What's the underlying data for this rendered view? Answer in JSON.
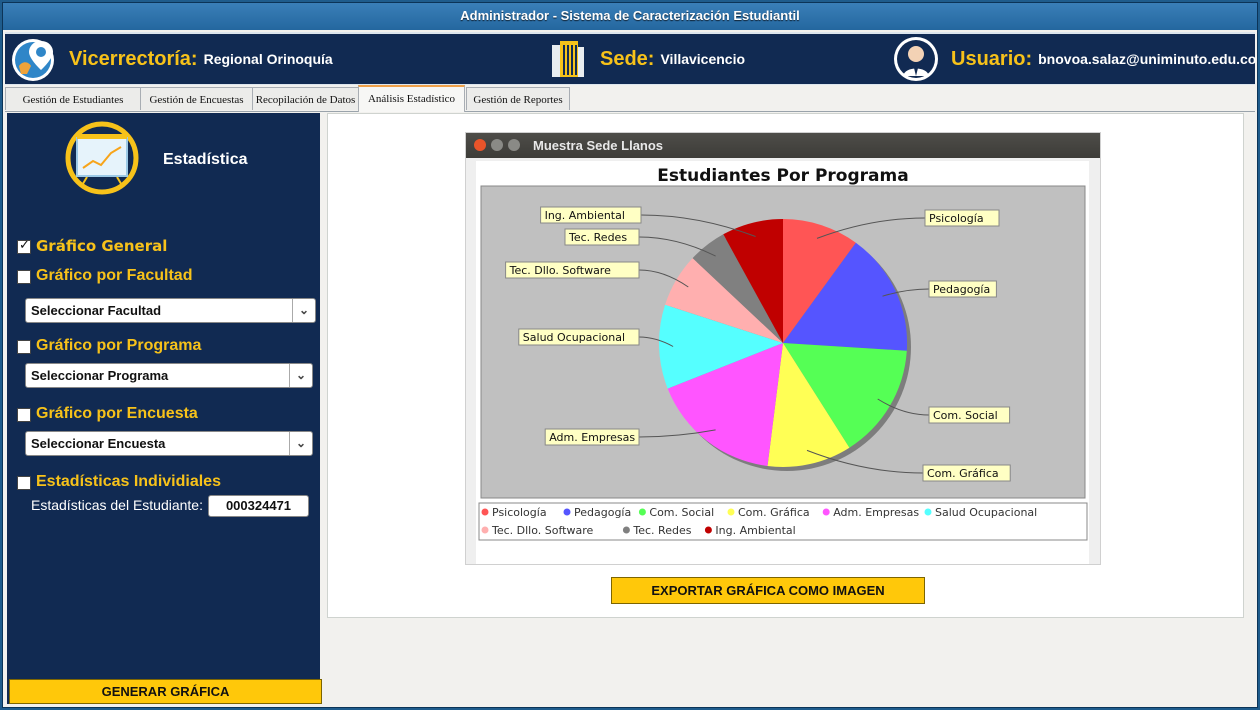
{
  "window": {
    "title": "Administrador - Sistema de Caracterización Estudiantil"
  },
  "header": {
    "vicerrectoria_key": "Vicerrectoría:",
    "vicerrectoria_value": "Regional Orinoquía",
    "sede_key": "Sede:",
    "sede_value": "Villavicencio",
    "usuario_key": "Usuario:",
    "usuario_value": "bnovoa.salaz@uniminuto.edu.co"
  },
  "tabs": [
    {
      "label": "Gestión de Estudiantes"
    },
    {
      "label": "Gestión de Encuestas"
    },
    {
      "label": "Recopilación de Datos"
    },
    {
      "label": "Análisis Estadístico",
      "active": true
    },
    {
      "label": "Gestión de Reportes"
    }
  ],
  "sidebar": {
    "title": "Estadística",
    "options": [
      {
        "label": "Gráfico General",
        "checked": true
      },
      {
        "label": "Gráfico por Facultad",
        "checked": false
      },
      {
        "label": "Gráfico por Programa",
        "checked": false
      },
      {
        "label": "Gráfico por Encuesta",
        "checked": false
      },
      {
        "label": "Estadísticas Individiales",
        "checked": false
      }
    ],
    "facultad_select": "Seleccionar Facultad",
    "programa_select": "Seleccionar Programa",
    "encuesta_select": "Seleccionar Encuesta",
    "student_label": "Estadísticas del Estudiante:",
    "student_id": "000324471",
    "generate_button": "GENERAR GRÁFICA"
  },
  "chart_window": {
    "title": "Muestra Sede Llanos"
  },
  "export_button": "EXPORTAR GRÁFICA COMO IMAGEN",
  "colors": {
    "accent": "#ffc80a",
    "header_bg": "#112a52",
    "label_yellow": "#f7c21a"
  },
  "chart_data": {
    "type": "pie",
    "title": "Estudiantes Por Programa",
    "unit": "percent",
    "slices": [
      {
        "label": "Psicología",
        "value": 10,
        "color": "#ff5555"
      },
      {
        "label": "Pedagogía",
        "value": 16,
        "color": "#5555ff"
      },
      {
        "label": "Com. Social",
        "value": 15,
        "color": "#55ff55"
      },
      {
        "label": "Com. Gráfica",
        "value": 11,
        "color": "#ffff55"
      },
      {
        "label": "Adm. Empresas",
        "value": 17,
        "color": "#ff55ff"
      },
      {
        "label": "Salud Ocupacional",
        "value": 11,
        "color": "#55ffff"
      },
      {
        "label": "Tec. Dllo. Software",
        "value": 7,
        "color": "#ffafaf"
      },
      {
        "label": "Tec. Redes",
        "value": 5,
        "color": "#808080"
      },
      {
        "label": "Ing. Ambiental",
        "value": 8,
        "color": "#c00000"
      }
    ],
    "legend_position": "bottom"
  }
}
